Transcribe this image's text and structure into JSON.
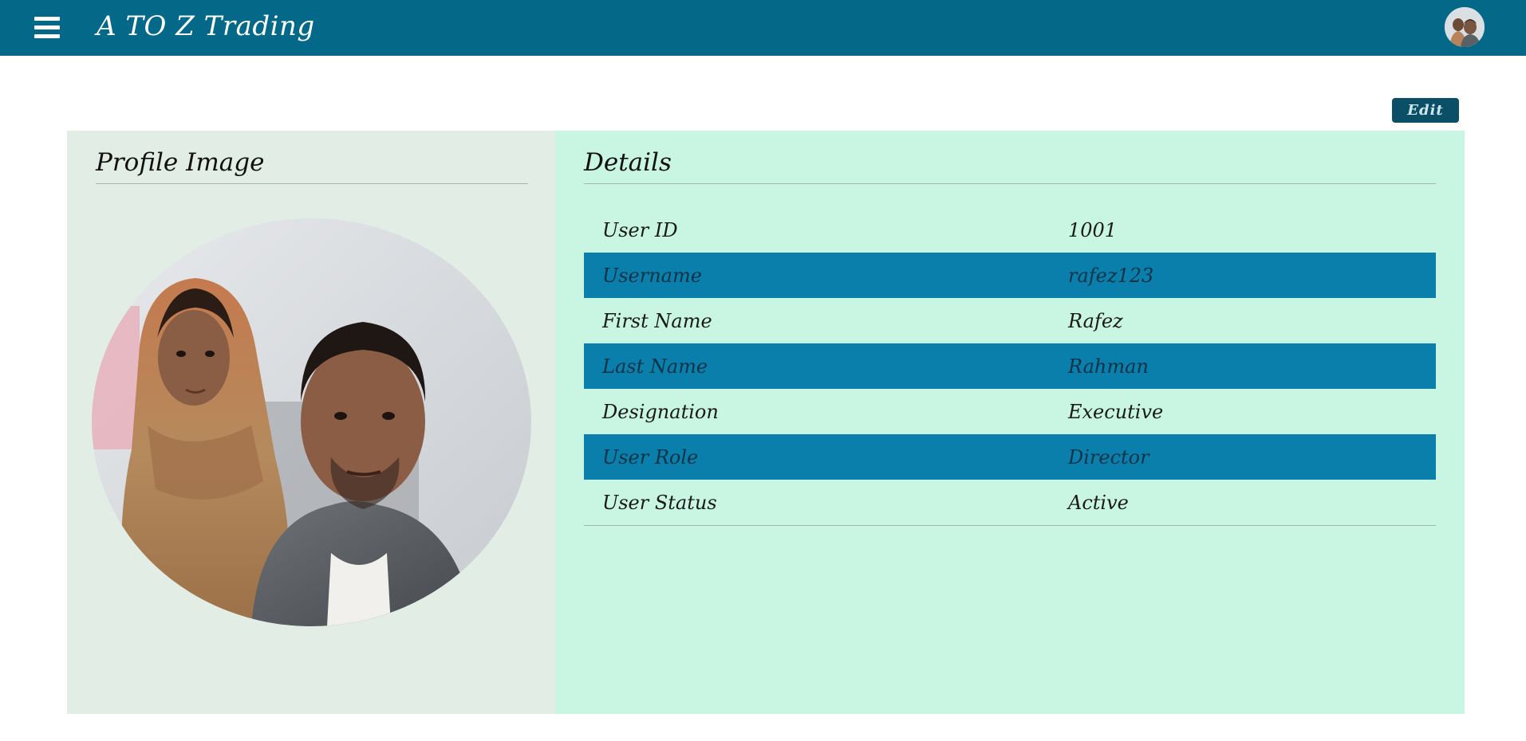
{
  "navbar": {
    "brand": "A TO Z Trading",
    "menu_icon": "hamburger-menu-icon",
    "avatar_alt": "user-avatar"
  },
  "toolbar": {
    "edit_label": "Edit"
  },
  "profile": {
    "title": "Profile Image"
  },
  "details": {
    "title": "Details",
    "rows": [
      {
        "label": "User ID",
        "value": "1001"
      },
      {
        "label": "Username",
        "value": "rafez123"
      },
      {
        "label": "First Name",
        "value": "Rafez"
      },
      {
        "label": "Last Name",
        "value": "Rahman"
      },
      {
        "label": "Designation",
        "value": "Executive"
      },
      {
        "label": "User Role",
        "value": "Director"
      },
      {
        "label": "User Status",
        "value": "Active"
      }
    ]
  },
  "colors": {
    "navbar": "#046889",
    "edit_button": "#0a4f66",
    "left_panel": "#e2ede6",
    "right_panel": "#c9f5e3",
    "row_highlight": "#0a7fab"
  }
}
